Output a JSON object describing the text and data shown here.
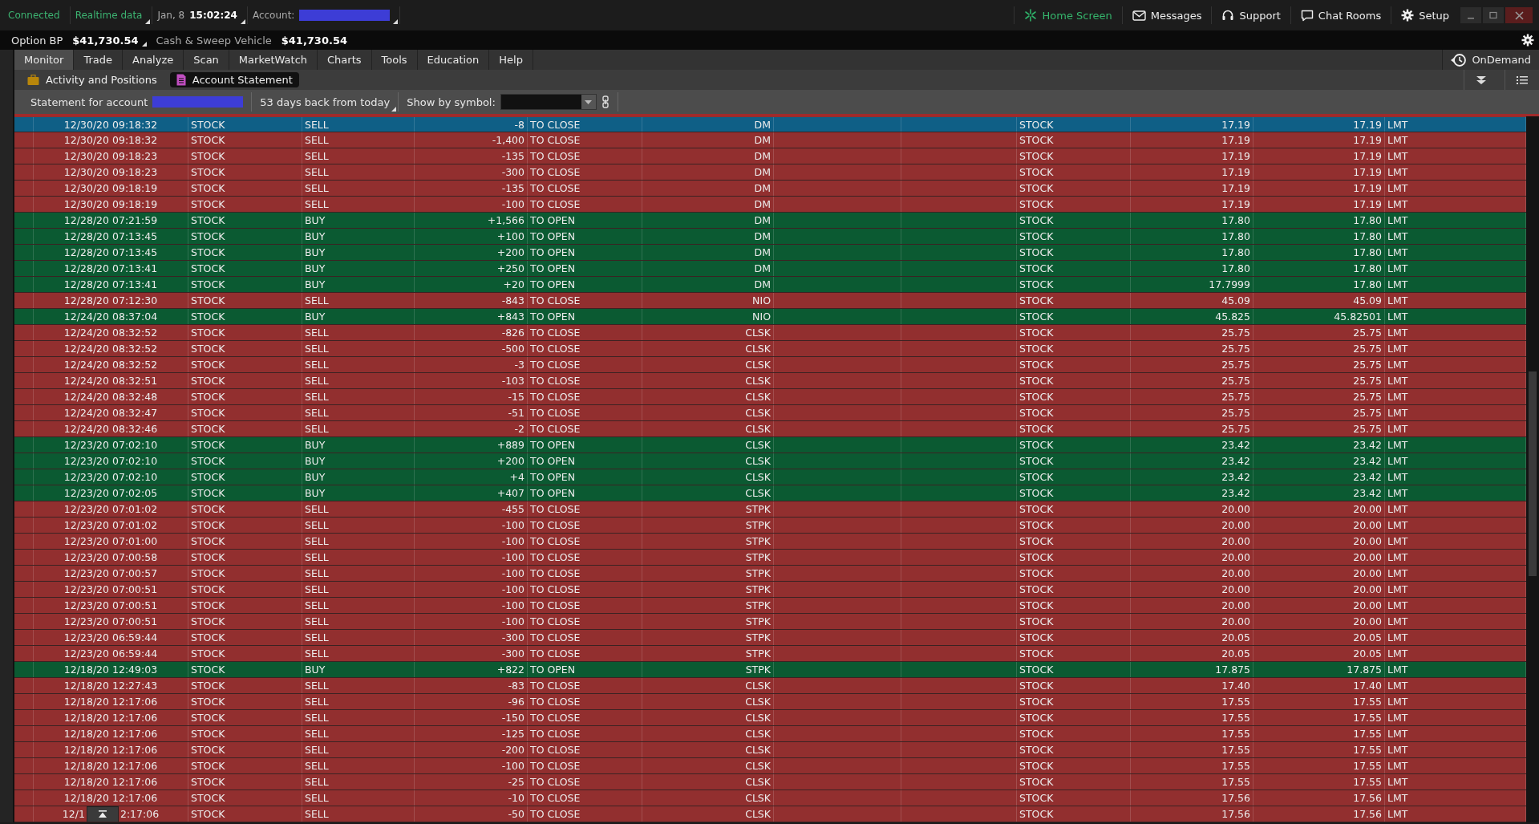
{
  "status": {
    "connected": "Connected",
    "realtime": "Realtime data",
    "date": "Jan, 8",
    "time": "15:02:24",
    "account_label": "Account:"
  },
  "top_links": [
    {
      "label": "Home Screen",
      "kind": "home"
    },
    {
      "label": "Messages",
      "kind": "messages"
    },
    {
      "label": "Support",
      "kind": "support"
    },
    {
      "label": "Chat Rooms",
      "kind": "chat"
    },
    {
      "label": "Setup",
      "kind": "setup"
    }
  ],
  "balances": [
    {
      "label": "Option BP",
      "value": "$41,730.54"
    },
    {
      "label": "Cash & Sweep Vehicle",
      "value": "$41,730.54"
    }
  ],
  "main_tabs": [
    {
      "label": "Monitor",
      "selected": true
    },
    {
      "label": "Trade",
      "selected": false
    },
    {
      "label": "Analyze",
      "selected": false
    },
    {
      "label": "Scan",
      "selected": false
    },
    {
      "label": "MarketWatch",
      "selected": false
    },
    {
      "label": "Charts",
      "selected": false
    },
    {
      "label": "Tools",
      "selected": false
    },
    {
      "label": "Education",
      "selected": false
    },
    {
      "label": "Help",
      "selected": false
    }
  ],
  "ondemand": "OnDemand",
  "sub_tabs": [
    {
      "label": "Activity and Positions",
      "selected": false,
      "kind": "briefcase"
    },
    {
      "label": "Account Statement",
      "selected": true,
      "kind": "document"
    }
  ],
  "toolbar": {
    "statement_label": "Statement for account",
    "days": "53 days back from today",
    "symbol_label": "Show by symbol:"
  },
  "rows": [
    {
      "time": "12/30/20 09:18:32",
      "type": "STOCK",
      "side": "SELL",
      "qty": "-8",
      "effect": "TO CLOSE",
      "symbol": "DM",
      "order": "STOCK",
      "price": "17.19",
      "net_price": "17.19",
      "price_type": "LMT",
      "kind": "sell",
      "selected": true
    },
    {
      "time": "12/30/20 09:18:32",
      "type": "STOCK",
      "side": "SELL",
      "qty": "-1,400",
      "effect": "TO CLOSE",
      "symbol": "DM",
      "order": "STOCK",
      "price": "17.19",
      "net_price": "17.19",
      "price_type": "LMT",
      "kind": "sell",
      "selected": false
    },
    {
      "time": "12/30/20 09:18:23",
      "type": "STOCK",
      "side": "SELL",
      "qty": "-135",
      "effect": "TO CLOSE",
      "symbol": "DM",
      "order": "STOCK",
      "price": "17.19",
      "net_price": "17.19",
      "price_type": "LMT",
      "kind": "sell",
      "selected": false
    },
    {
      "time": "12/30/20 09:18:23",
      "type": "STOCK",
      "side": "SELL",
      "qty": "-300",
      "effect": "TO CLOSE",
      "symbol": "DM",
      "order": "STOCK",
      "price": "17.19",
      "net_price": "17.19",
      "price_type": "LMT",
      "kind": "sell",
      "selected": false
    },
    {
      "time": "12/30/20 09:18:19",
      "type": "STOCK",
      "side": "SELL",
      "qty": "-135",
      "effect": "TO CLOSE",
      "symbol": "DM",
      "order": "STOCK",
      "price": "17.19",
      "net_price": "17.19",
      "price_type": "LMT",
      "kind": "sell",
      "selected": false
    },
    {
      "time": "12/30/20 09:18:19",
      "type": "STOCK",
      "side": "SELL",
      "qty": "-100",
      "effect": "TO CLOSE",
      "symbol": "DM",
      "order": "STOCK",
      "price": "17.19",
      "net_price": "17.19",
      "price_type": "LMT",
      "kind": "sell",
      "selected": false
    },
    {
      "time": "12/28/20 07:21:59",
      "type": "STOCK",
      "side": "BUY",
      "qty": "+1,566",
      "effect": "TO OPEN",
      "symbol": "DM",
      "order": "STOCK",
      "price": "17.80",
      "net_price": "17.80",
      "price_type": "LMT",
      "kind": "buy",
      "selected": false
    },
    {
      "time": "12/28/20 07:13:45",
      "type": "STOCK",
      "side": "BUY",
      "qty": "+100",
      "effect": "TO OPEN",
      "symbol": "DM",
      "order": "STOCK",
      "price": "17.80",
      "net_price": "17.80",
      "price_type": "LMT",
      "kind": "buy",
      "selected": false
    },
    {
      "time": "12/28/20 07:13:45",
      "type": "STOCK",
      "side": "BUY",
      "qty": "+200",
      "effect": "TO OPEN",
      "symbol": "DM",
      "order": "STOCK",
      "price": "17.80",
      "net_price": "17.80",
      "price_type": "LMT",
      "kind": "buy",
      "selected": false
    },
    {
      "time": "12/28/20 07:13:41",
      "type": "STOCK",
      "side": "BUY",
      "qty": "+250",
      "effect": "TO OPEN",
      "symbol": "DM",
      "order": "STOCK",
      "price": "17.80",
      "net_price": "17.80",
      "price_type": "LMT",
      "kind": "buy",
      "selected": false
    },
    {
      "time": "12/28/20 07:13:41",
      "type": "STOCK",
      "side": "BUY",
      "qty": "+20",
      "effect": "TO OPEN",
      "symbol": "DM",
      "order": "STOCK",
      "price": "17.7999",
      "net_price": "17.80",
      "price_type": "LMT",
      "kind": "buy",
      "selected": false
    },
    {
      "time": "12/28/20 07:12:30",
      "type": "STOCK",
      "side": "SELL",
      "qty": "-843",
      "effect": "TO CLOSE",
      "symbol": "NIO",
      "order": "STOCK",
      "price": "45.09",
      "net_price": "45.09",
      "price_type": "LMT",
      "kind": "sell",
      "selected": false
    },
    {
      "time": "12/24/20 08:37:04",
      "type": "STOCK",
      "side": "BUY",
      "qty": "+843",
      "effect": "TO OPEN",
      "symbol": "NIO",
      "order": "STOCK",
      "price": "45.825",
      "net_price": "45.82501",
      "price_type": "LMT",
      "kind": "buy",
      "selected": false
    },
    {
      "time": "12/24/20 08:32:52",
      "type": "STOCK",
      "side": "SELL",
      "qty": "-826",
      "effect": "TO CLOSE",
      "symbol": "CLSK",
      "order": "STOCK",
      "price": "25.75",
      "net_price": "25.75",
      "price_type": "LMT",
      "kind": "sell",
      "selected": false
    },
    {
      "time": "12/24/20 08:32:52",
      "type": "STOCK",
      "side": "SELL",
      "qty": "-500",
      "effect": "TO CLOSE",
      "symbol": "CLSK",
      "order": "STOCK",
      "price": "25.75",
      "net_price": "25.75",
      "price_type": "LMT",
      "kind": "sell",
      "selected": false
    },
    {
      "time": "12/24/20 08:32:52",
      "type": "STOCK",
      "side": "SELL",
      "qty": "-3",
      "effect": "TO CLOSE",
      "symbol": "CLSK",
      "order": "STOCK",
      "price": "25.75",
      "net_price": "25.75",
      "price_type": "LMT",
      "kind": "sell",
      "selected": false
    },
    {
      "time": "12/24/20 08:32:51",
      "type": "STOCK",
      "side": "SELL",
      "qty": "-103",
      "effect": "TO CLOSE",
      "symbol": "CLSK",
      "order": "STOCK",
      "price": "25.75",
      "net_price": "25.75",
      "price_type": "LMT",
      "kind": "sell",
      "selected": false
    },
    {
      "time": "12/24/20 08:32:48",
      "type": "STOCK",
      "side": "SELL",
      "qty": "-15",
      "effect": "TO CLOSE",
      "symbol": "CLSK",
      "order": "STOCK",
      "price": "25.75",
      "net_price": "25.75",
      "price_type": "LMT",
      "kind": "sell",
      "selected": false
    },
    {
      "time": "12/24/20 08:32:47",
      "type": "STOCK",
      "side": "SELL",
      "qty": "-51",
      "effect": "TO CLOSE",
      "symbol": "CLSK",
      "order": "STOCK",
      "price": "25.75",
      "net_price": "25.75",
      "price_type": "LMT",
      "kind": "sell",
      "selected": false
    },
    {
      "time": "12/24/20 08:32:46",
      "type": "STOCK",
      "side": "SELL",
      "qty": "-2",
      "effect": "TO CLOSE",
      "symbol": "CLSK",
      "order": "STOCK",
      "price": "25.75",
      "net_price": "25.75",
      "price_type": "LMT",
      "kind": "sell",
      "selected": false
    },
    {
      "time": "12/23/20 07:02:10",
      "type": "STOCK",
      "side": "BUY",
      "qty": "+889",
      "effect": "TO OPEN",
      "symbol": "CLSK",
      "order": "STOCK",
      "price": "23.42",
      "net_price": "23.42",
      "price_type": "LMT",
      "kind": "buy",
      "selected": false
    },
    {
      "time": "12/23/20 07:02:10",
      "type": "STOCK",
      "side": "BUY",
      "qty": "+200",
      "effect": "TO OPEN",
      "symbol": "CLSK",
      "order": "STOCK",
      "price": "23.42",
      "net_price": "23.42",
      "price_type": "LMT",
      "kind": "buy",
      "selected": false
    },
    {
      "time": "12/23/20 07:02:10",
      "type": "STOCK",
      "side": "BUY",
      "qty": "+4",
      "effect": "TO OPEN",
      "symbol": "CLSK",
      "order": "STOCK",
      "price": "23.42",
      "net_price": "23.42",
      "price_type": "LMT",
      "kind": "buy",
      "selected": false
    },
    {
      "time": "12/23/20 07:02:05",
      "type": "STOCK",
      "side": "BUY",
      "qty": "+407",
      "effect": "TO OPEN",
      "symbol": "CLSK",
      "order": "STOCK",
      "price": "23.42",
      "net_price": "23.42",
      "price_type": "LMT",
      "kind": "buy",
      "selected": false
    },
    {
      "time": "12/23/20 07:01:02",
      "type": "STOCK",
      "side": "SELL",
      "qty": "-455",
      "effect": "TO CLOSE",
      "symbol": "STPK",
      "order": "STOCK",
      "price": "20.00",
      "net_price": "20.00",
      "price_type": "LMT",
      "kind": "sell",
      "selected": false
    },
    {
      "time": "12/23/20 07:01:02",
      "type": "STOCK",
      "side": "SELL",
      "qty": "-100",
      "effect": "TO CLOSE",
      "symbol": "STPK",
      "order": "STOCK",
      "price": "20.00",
      "net_price": "20.00",
      "price_type": "LMT",
      "kind": "sell",
      "selected": false
    },
    {
      "time": "12/23/20 07:01:00",
      "type": "STOCK",
      "side": "SELL",
      "qty": "-100",
      "effect": "TO CLOSE",
      "symbol": "STPK",
      "order": "STOCK",
      "price": "20.00",
      "net_price": "20.00",
      "price_type": "LMT",
      "kind": "sell",
      "selected": false
    },
    {
      "time": "12/23/20 07:00:58",
      "type": "STOCK",
      "side": "SELL",
      "qty": "-100",
      "effect": "TO CLOSE",
      "symbol": "STPK",
      "order": "STOCK",
      "price": "20.00",
      "net_price": "20.00",
      "price_type": "LMT",
      "kind": "sell",
      "selected": false
    },
    {
      "time": "12/23/20 07:00:57",
      "type": "STOCK",
      "side": "SELL",
      "qty": "-100",
      "effect": "TO CLOSE",
      "symbol": "STPK",
      "order": "STOCK",
      "price": "20.00",
      "net_price": "20.00",
      "price_type": "LMT",
      "kind": "sell",
      "selected": false
    },
    {
      "time": "12/23/20 07:00:51",
      "type": "STOCK",
      "side": "SELL",
      "qty": "-100",
      "effect": "TO CLOSE",
      "symbol": "STPK",
      "order": "STOCK",
      "price": "20.00",
      "net_price": "20.00",
      "price_type": "LMT",
      "kind": "sell",
      "selected": false
    },
    {
      "time": "12/23/20 07:00:51",
      "type": "STOCK",
      "side": "SELL",
      "qty": "-100",
      "effect": "TO CLOSE",
      "symbol": "STPK",
      "order": "STOCK",
      "price": "20.00",
      "net_price": "20.00",
      "price_type": "LMT",
      "kind": "sell",
      "selected": false
    },
    {
      "time": "12/23/20 07:00:51",
      "type": "STOCK",
      "side": "SELL",
      "qty": "-100",
      "effect": "TO CLOSE",
      "symbol": "STPK",
      "order": "STOCK",
      "price": "20.00",
      "net_price": "20.00",
      "price_type": "LMT",
      "kind": "sell",
      "selected": false
    },
    {
      "time": "12/23/20 06:59:44",
      "type": "STOCK",
      "side": "SELL",
      "qty": "-300",
      "effect": "TO CLOSE",
      "symbol": "STPK",
      "order": "STOCK",
      "price": "20.05",
      "net_price": "20.05",
      "price_type": "LMT",
      "kind": "sell",
      "selected": false
    },
    {
      "time": "12/23/20 06:59:44",
      "type": "STOCK",
      "side": "SELL",
      "qty": "-300",
      "effect": "TO CLOSE",
      "symbol": "STPK",
      "order": "STOCK",
      "price": "20.05",
      "net_price": "20.05",
      "price_type": "LMT",
      "kind": "sell",
      "selected": false
    },
    {
      "time": "12/18/20 12:49:03",
      "type": "STOCK",
      "side": "BUY",
      "qty": "+822",
      "effect": "TO OPEN",
      "symbol": "STPK",
      "order": "STOCK",
      "price": "17.875",
      "net_price": "17.875",
      "price_type": "LMT",
      "kind": "buy",
      "selected": false
    },
    {
      "time": "12/18/20 12:27:43",
      "type": "STOCK",
      "side": "SELL",
      "qty": "-83",
      "effect": "TO CLOSE",
      "symbol": "CLSK",
      "order": "STOCK",
      "price": "17.40",
      "net_price": "17.40",
      "price_type": "LMT",
      "kind": "sell",
      "selected": false
    },
    {
      "time": "12/18/20 12:17:06",
      "type": "STOCK",
      "side": "SELL",
      "qty": "-96",
      "effect": "TO CLOSE",
      "symbol": "CLSK",
      "order": "STOCK",
      "price": "17.55",
      "net_price": "17.55",
      "price_type": "LMT",
      "kind": "sell",
      "selected": false
    },
    {
      "time": "12/18/20 12:17:06",
      "type": "STOCK",
      "side": "SELL",
      "qty": "-150",
      "effect": "TO CLOSE",
      "symbol": "CLSK",
      "order": "STOCK",
      "price": "17.55",
      "net_price": "17.55",
      "price_type": "LMT",
      "kind": "sell",
      "selected": false
    },
    {
      "time": "12/18/20 12:17:06",
      "type": "STOCK",
      "side": "SELL",
      "qty": "-125",
      "effect": "TO CLOSE",
      "symbol": "CLSK",
      "order": "STOCK",
      "price": "17.55",
      "net_price": "17.55",
      "price_type": "LMT",
      "kind": "sell",
      "selected": false
    },
    {
      "time": "12/18/20 12:17:06",
      "type": "STOCK",
      "side": "SELL",
      "qty": "-200",
      "effect": "TO CLOSE",
      "symbol": "CLSK",
      "order": "STOCK",
      "price": "17.55",
      "net_price": "17.55",
      "price_type": "LMT",
      "kind": "sell",
      "selected": false
    },
    {
      "time": "12/18/20 12:17:06",
      "type": "STOCK",
      "side": "SELL",
      "qty": "-100",
      "effect": "TO CLOSE",
      "symbol": "CLSK",
      "order": "STOCK",
      "price": "17.55",
      "net_price": "17.55",
      "price_type": "LMT",
      "kind": "sell",
      "selected": false
    },
    {
      "time": "12/18/20 12:17:06",
      "type": "STOCK",
      "side": "SELL",
      "qty": "-25",
      "effect": "TO CLOSE",
      "symbol": "CLSK",
      "order": "STOCK",
      "price": "17.55",
      "net_price": "17.55",
      "price_type": "LMT",
      "kind": "sell",
      "selected": false
    },
    {
      "time": "12/18/20 12:17:06",
      "type": "STOCK",
      "side": "SELL",
      "qty": "-10",
      "effect": "TO CLOSE",
      "symbol": "CLSK",
      "order": "STOCK",
      "price": "17.56",
      "net_price": "17.56",
      "price_type": "LMT",
      "kind": "sell",
      "selected": false
    },
    {
      "time": "12/1",
      "time_tail": "2:17:06",
      "type": "STOCK",
      "side": "SELL",
      "qty": "-50",
      "effect": "TO CLOSE",
      "symbol": "CLSK",
      "order": "STOCK",
      "price": "17.56",
      "net_price": "17.56",
      "price_type": "LMT",
      "kind": "sell",
      "selected": false
    }
  ]
}
